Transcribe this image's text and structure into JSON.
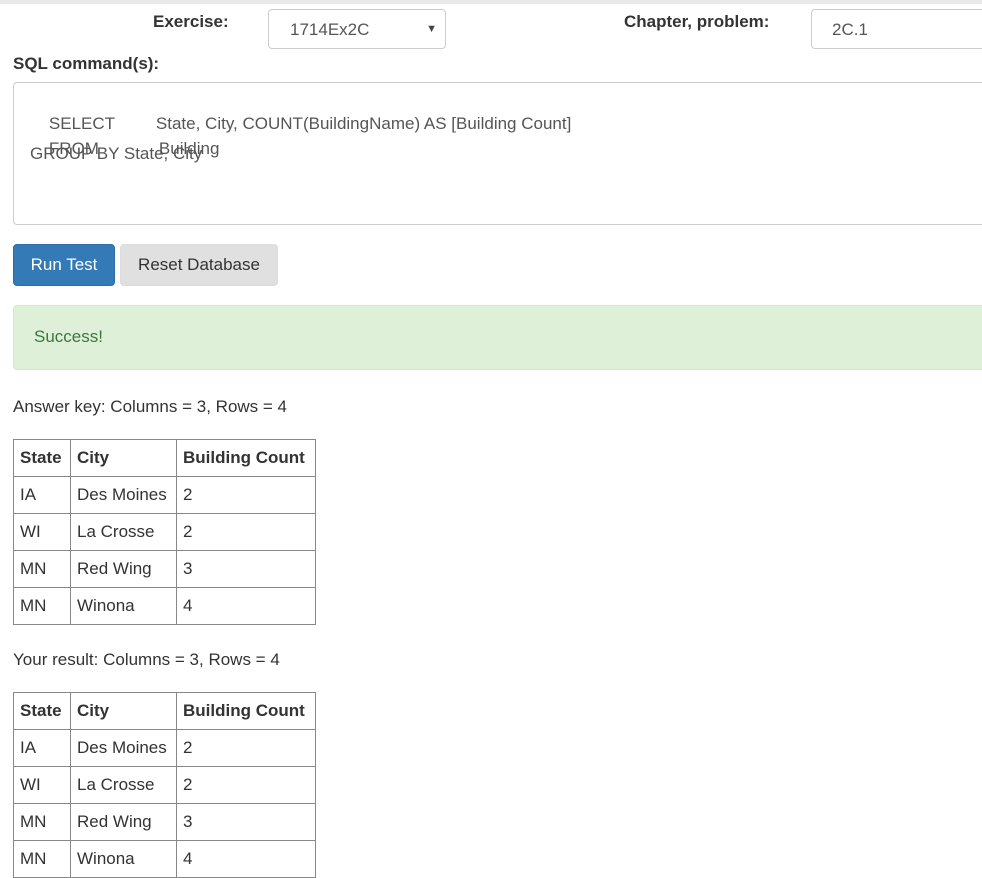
{
  "form": {
    "exercise_label": "Exercise:",
    "exercise_value": "1714Ex2C",
    "chapter_label": "Chapter, problem:",
    "chapter_value": "2C.1",
    "sql_label": "SQL command(s):"
  },
  "sql": {
    "line1_kw": "SELECT",
    "line1_rest": "State, City, COUNT(BuildingName) AS [Building Count]",
    "line2_kw": "FROM",
    "line2_rest": "Building",
    "line3": "GROUP BY State, City"
  },
  "buttons": {
    "run_label": "Run Test",
    "reset_label": "Reset Database"
  },
  "alert": {
    "message": "Success!"
  },
  "answer_key": {
    "summary": "Answer key: Columns = 3, Rows = 4",
    "headers": [
      "State",
      "City",
      "Building Count"
    ],
    "rows": [
      [
        "IA",
        "Des Moines",
        "2"
      ],
      [
        "WI",
        "La Crosse",
        "2"
      ],
      [
        "MN",
        "Red Wing",
        "3"
      ],
      [
        "MN",
        "Winona",
        "4"
      ]
    ]
  },
  "your_result": {
    "summary": "Your result: Columns = 3, Rows = 4",
    "headers": [
      "State",
      "City",
      "Building Count"
    ],
    "rows": [
      [
        "IA",
        "Des Moines",
        "2"
      ],
      [
        "WI",
        "La Crosse",
        "2"
      ],
      [
        "MN",
        "Red Wing",
        "3"
      ],
      [
        "MN",
        "Winona",
        "4"
      ]
    ]
  },
  "icons": {
    "select_caret": "caret-down-icon"
  }
}
